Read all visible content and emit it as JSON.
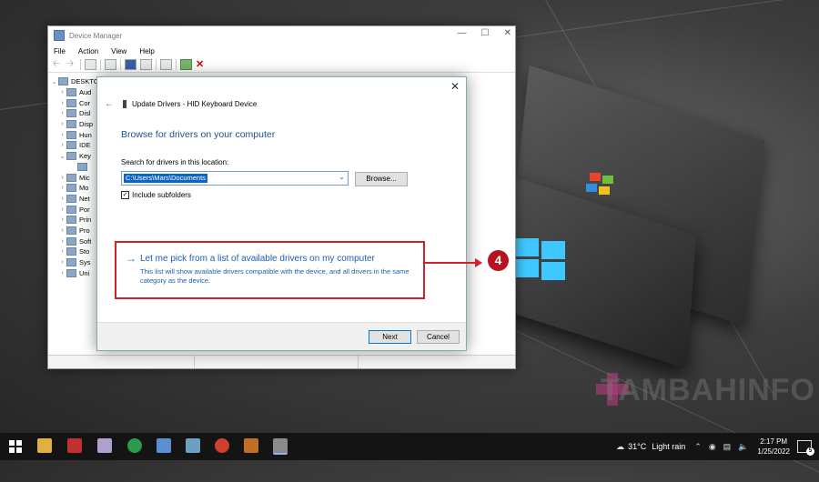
{
  "colors": {
    "accent": "#1b4f87",
    "link": "#1b5fae",
    "highlight": "#d0202e",
    "selection": "#0a66c9"
  },
  "device_manager": {
    "title": "Device Manager",
    "menu": [
      "File",
      "Action",
      "View",
      "Help"
    ],
    "tree_root": "DESKTO",
    "tree_items": [
      "Aud",
      "Cor",
      "Disl",
      "Disp",
      "Hun",
      "IDE",
      "Key",
      "",
      "Mic",
      "Mo",
      "Net",
      "Por",
      "Prin",
      "Pro",
      "Soft",
      "Sto",
      "Sys",
      "Uni"
    ]
  },
  "dialog": {
    "header": "Update Drivers - HID Keyboard Device",
    "heading": "Browse for drivers on your computer",
    "search_label": "Search for drivers in this location:",
    "path_value": "C:\\Users\\Mars\\Documents",
    "browse_label": "Browse...",
    "include_subfolders_label": "Include subfolders",
    "include_subfolders_checked": true,
    "pick_title": "Let me pick from a list of available drivers on my computer",
    "pick_desc": "This list will show available drivers compatible with the device, and all drivers in the same category as the device.",
    "next_label": "Next",
    "cancel_label": "Cancel"
  },
  "annotation": {
    "step": "4"
  },
  "watermark": {
    "text": "TAMBAHINFO"
  },
  "taskbar": {
    "weather_temp": "31°C",
    "weather_desc": "Light rain",
    "time": "2:17 PM",
    "date": "1/25/2022",
    "notification_count": "5"
  }
}
